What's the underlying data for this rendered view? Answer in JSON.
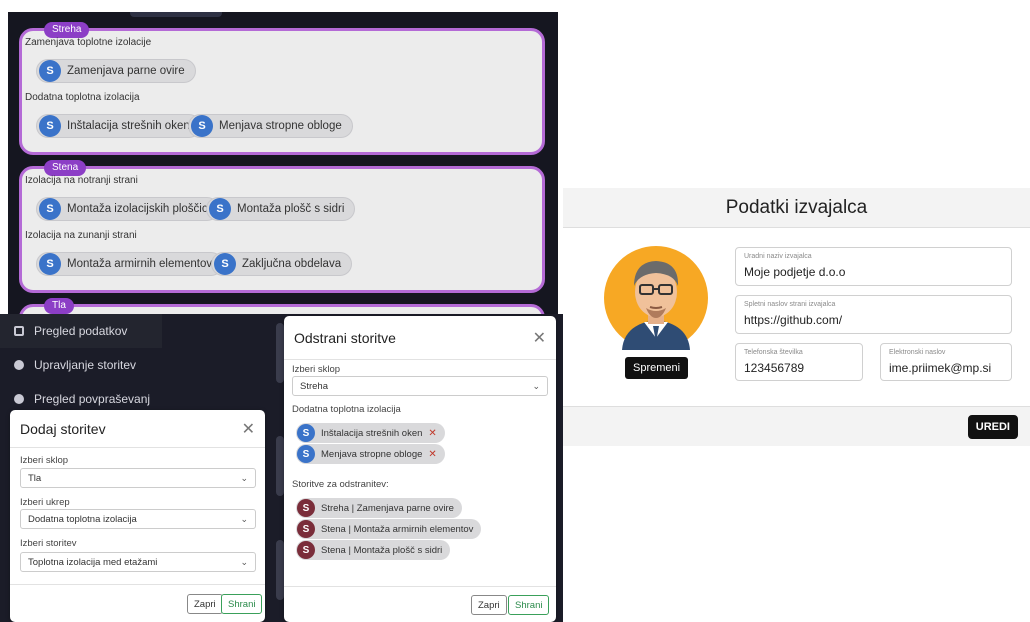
{
  "service_groups": [
    {
      "name": "Streha",
      "subgroups": [
        {
          "label": "Zamenjava toplotne izolacije",
          "items": [
            "Zamenjava parne ovire"
          ]
        },
        {
          "label": "Dodatna toplotna izolacija",
          "items": [
            "Inštalacija strešnih oken",
            "Menjava stropne obloge"
          ]
        }
      ]
    },
    {
      "name": "Stena",
      "subgroups": [
        {
          "label": "Izolacija na notranji strani",
          "items": [
            "Montaža izolacijskih ploščic",
            "Montaža plošč s sidri"
          ]
        },
        {
          "label": "Izolacija na zunanji strani",
          "items": [
            "Montaža armirnih elementov",
            "Zaključna obdelava"
          ]
        }
      ]
    },
    {
      "name": "Tla",
      "subgroups": []
    }
  ],
  "chip_avatar_letter": "S",
  "sidebar": {
    "items": [
      {
        "label": "Pregled podatkov",
        "icon": "grid-icon"
      },
      {
        "label": "Upravljanje storitev",
        "icon": "circle-icon"
      },
      {
        "label": "Pregled povpraševanj",
        "icon": "circle-icon"
      }
    ]
  },
  "add_dialog": {
    "title": "Dodaj storitev",
    "sklop_label": "Izberi sklop",
    "sklop_value": "Tla",
    "ukrep_label": "Izberi ukrep",
    "ukrep_value": "Dodatna toplotna izolacija",
    "storitev_label": "Izberi storitev",
    "storitev_value": "Toplotna izolacija med etažami",
    "cancel": "Zapri",
    "save": "Shrani"
  },
  "remove_dialog": {
    "title": "Odstrani storitve",
    "sklop_label": "Izberi sklop",
    "sklop_value": "Streha",
    "group_label": "Dodatna toplotna izolacija",
    "group_items": [
      "Inštalacija strešnih oken",
      "Menjava stropne obloge"
    ],
    "to_remove_label": "Storitve za odstranitev:",
    "to_remove": [
      "Streha | Zamenjava parne ovire",
      "Stena | Montaža armirnih elementov",
      "Stena | Montaža plošč s sidri"
    ],
    "cancel": "Zapri",
    "save": "Shrani"
  },
  "contractor": {
    "title": "Podatki izvajalca",
    "save": "Spremeni",
    "edit": "UREDI",
    "fields": {
      "name_label": "Uradni naziv izvajalca",
      "name_value": "Moje podjetje d.o.o",
      "web_label": "Spletni naslov strani izvajalca",
      "web_value": "https://github.com/",
      "phone_label": "Telefonska številka",
      "phone_value": "123456789",
      "email_label": "Elektronski naslov",
      "email_value": "ime.priimek@mp.si"
    }
  },
  "colors": {
    "group_border": "#b46ad6",
    "badge": "#8c3ec6",
    "chip_avatar": "#3a73c9",
    "remove_avatar": "#7a2d3a",
    "dark_bg": "#151620"
  }
}
